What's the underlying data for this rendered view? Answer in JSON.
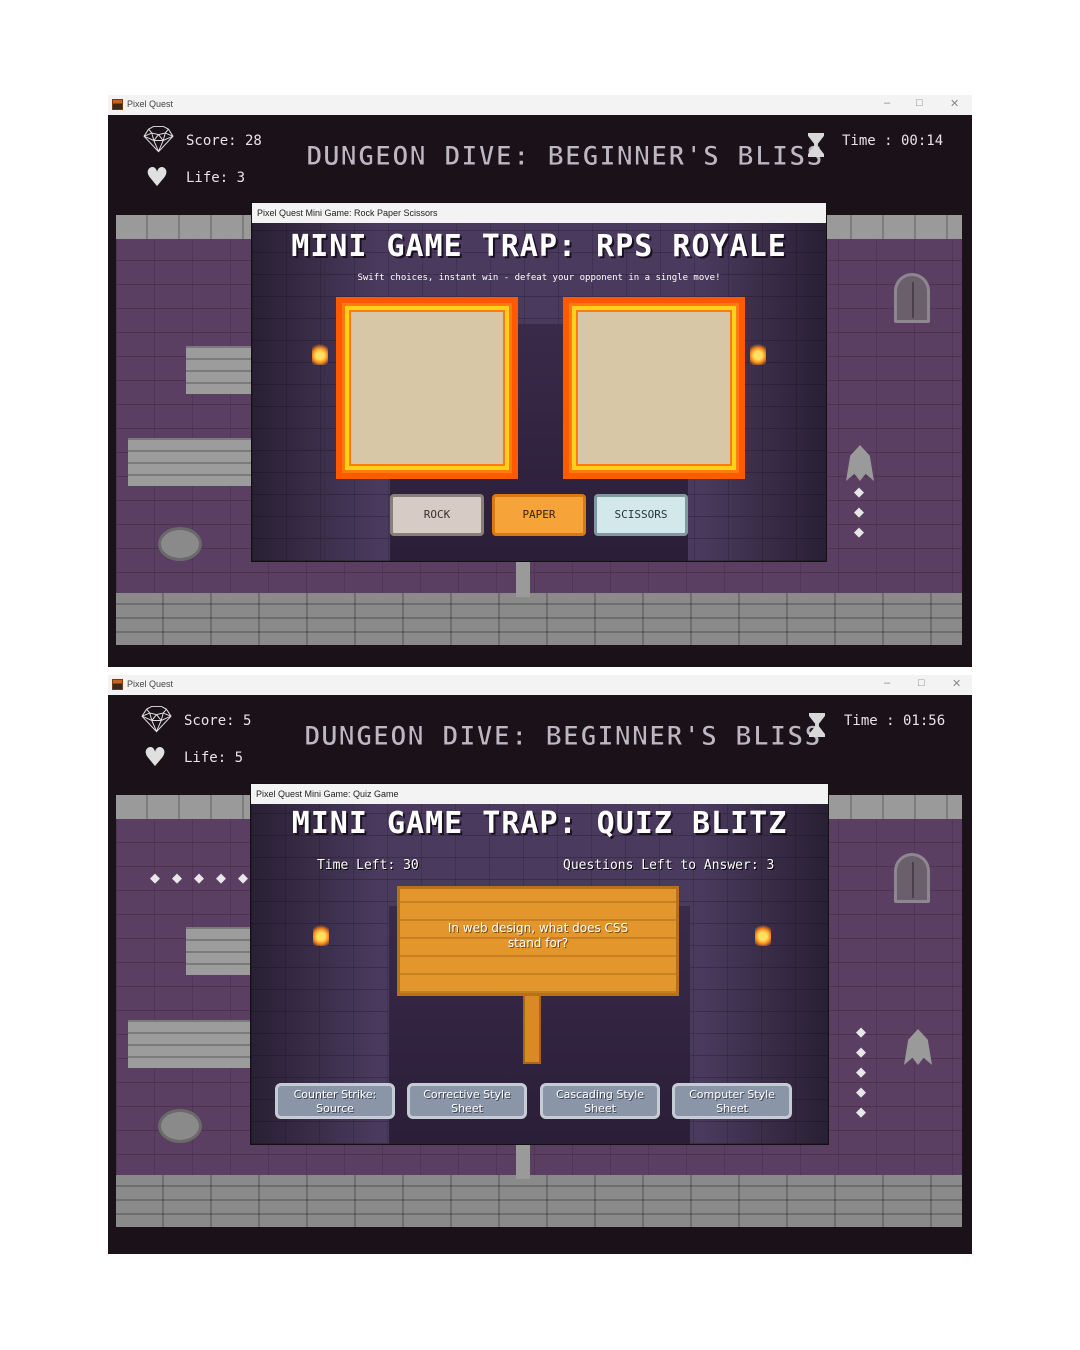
{
  "app": {
    "title": "Pixel Quest",
    "window_controls": [
      "–",
      "□",
      "✕"
    ]
  },
  "screens": [
    {
      "hud": {
        "score": "Score: 28",
        "life": "Life: 3",
        "time": "Time : 00:14",
        "level_title": "DUNGEON DIVE: BEGINNER'S BLISS"
      },
      "dialog": {
        "title": "Pixel Quest Mini Game: Rock Paper Scissors",
        "heading": "MINI GAME TRAP: RPS ROYALE",
        "subtitle": "Swift choices, instant win - defeat your opponent in a single move!",
        "buttons": [
          "ROCK",
          "PAPER",
          "SCISSORS"
        ]
      }
    },
    {
      "hud": {
        "score": "Score: 5",
        "life": "Life: 5",
        "time": "Time : 01:56",
        "level_title": "DUNGEON DIVE: BEGINNER'S BLISS"
      },
      "dialog": {
        "title": "Pixel Quest Mini Game: Quiz Game",
        "heading": "MINI GAME TRAP: QUIZ BLITZ",
        "time_left": "Time Left: 30",
        "questions_left": "Questions Left to Answer: 3",
        "question": "In web design, what does CSS stand for?",
        "answers": [
          [
            "Counter Strike:",
            "Source"
          ],
          [
            "Corrective Style",
            "Sheet"
          ],
          [
            "Cascading Style",
            "Sheet"
          ],
          [
            "Computer Style",
            "Sheet"
          ]
        ]
      }
    }
  ],
  "icons": {
    "score": "diamond-icon",
    "life": "heart-icon",
    "time": "hourglass-icon",
    "gem": "diamond-icon"
  },
  "colors": {
    "frame_orange": "#ff7a10",
    "frame_yellow": "#ffd21a",
    "paper_button": "#f6a43a",
    "scissors_button": "#d3e8ea",
    "rock_button": "#d7cbc6",
    "sign_wood": "#e2962c"
  }
}
